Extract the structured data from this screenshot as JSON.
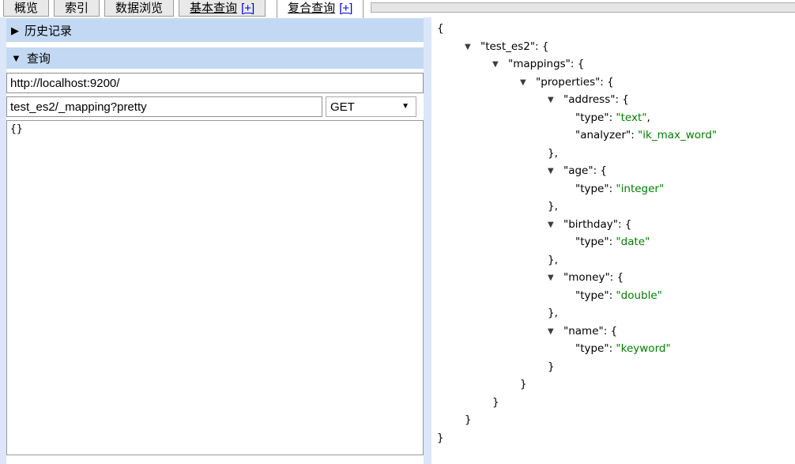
{
  "tabs": [
    {
      "label": "概览",
      "plus": "",
      "active": false,
      "underline": false
    },
    {
      "label": "索引",
      "plus": "",
      "active": false,
      "underline": false
    },
    {
      "label": "数据浏览",
      "plus": "",
      "active": false,
      "underline": false
    },
    {
      "label": "基本查询",
      "plus": "[+]",
      "active": false,
      "underline": true
    },
    {
      "label": "复合查询",
      "plus": "[+]",
      "active": true,
      "underline": true
    }
  ],
  "query_panel": {
    "history_header": "历史记录",
    "history_collapsed_icon": "collapsed-triangle-right",
    "query_header": "查询",
    "query_expanded_icon": "expanded-triangle-down",
    "url_value": "http://localhost:9200/",
    "path_value": "test_es2/_mapping?pretty",
    "method": "GET",
    "body_value": "{}"
  },
  "colors": {
    "panel_blue": "#dbe7f8",
    "header_blue": "#c3d9f3",
    "link_blue": "#0000e0",
    "json_string_green": "#008000"
  },
  "json_tree": {
    "lines": [
      {
        "level": 0,
        "arrow": false,
        "tokens": [
          {
            "t": "{",
            "c": "p"
          }
        ]
      },
      {
        "level": 1,
        "arrow": true,
        "tokens": [
          {
            "t": "\"test_es2\": {",
            "c": "p"
          }
        ]
      },
      {
        "level": 2,
        "arrow": true,
        "tokens": [
          {
            "t": "\"mappings\": {",
            "c": "p"
          }
        ]
      },
      {
        "level": 3,
        "arrow": true,
        "tokens": [
          {
            "t": "\"properties\": {",
            "c": "p"
          }
        ]
      },
      {
        "level": 4,
        "arrow": true,
        "tokens": [
          {
            "t": "\"address\": {",
            "c": "p"
          }
        ]
      },
      {
        "level": 5,
        "arrow": false,
        "tokens": [
          {
            "t": "\"type\": ",
            "c": "p"
          },
          {
            "t": "\"text\"",
            "c": "s"
          },
          {
            "t": ",",
            "c": "p"
          }
        ]
      },
      {
        "level": 5,
        "arrow": false,
        "tokens": [
          {
            "t": "\"analyzer\": ",
            "c": "p"
          },
          {
            "t": "\"ik_max_word\"",
            "c": "s"
          }
        ]
      },
      {
        "level": 4,
        "arrow": false,
        "tokens": [
          {
            "t": "},",
            "c": "p"
          }
        ]
      },
      {
        "level": 4,
        "arrow": true,
        "tokens": [
          {
            "t": "\"age\": {",
            "c": "p"
          }
        ]
      },
      {
        "level": 5,
        "arrow": false,
        "tokens": [
          {
            "t": "\"type\": ",
            "c": "p"
          },
          {
            "t": "\"integer\"",
            "c": "s"
          }
        ]
      },
      {
        "level": 4,
        "arrow": false,
        "tokens": [
          {
            "t": "},",
            "c": "p"
          }
        ]
      },
      {
        "level": 4,
        "arrow": true,
        "tokens": [
          {
            "t": "\"birthday\": {",
            "c": "p"
          }
        ]
      },
      {
        "level": 5,
        "arrow": false,
        "tokens": [
          {
            "t": "\"type\": ",
            "c": "p"
          },
          {
            "t": "\"date\"",
            "c": "s"
          }
        ]
      },
      {
        "level": 4,
        "arrow": false,
        "tokens": [
          {
            "t": "},",
            "c": "p"
          }
        ]
      },
      {
        "level": 4,
        "arrow": true,
        "tokens": [
          {
            "t": "\"money\": {",
            "c": "p"
          }
        ]
      },
      {
        "level": 5,
        "arrow": false,
        "tokens": [
          {
            "t": "\"type\": ",
            "c": "p"
          },
          {
            "t": "\"double\"",
            "c": "s"
          }
        ]
      },
      {
        "level": 4,
        "arrow": false,
        "tokens": [
          {
            "t": "},",
            "c": "p"
          }
        ]
      },
      {
        "level": 4,
        "arrow": true,
        "tokens": [
          {
            "t": "\"name\": {",
            "c": "p"
          }
        ]
      },
      {
        "level": 5,
        "arrow": false,
        "tokens": [
          {
            "t": "\"type\": ",
            "c": "p"
          },
          {
            "t": "\"keyword\"",
            "c": "s"
          }
        ]
      },
      {
        "level": 4,
        "arrow": false,
        "tokens": [
          {
            "t": "}",
            "c": "p"
          }
        ]
      },
      {
        "level": 3,
        "arrow": false,
        "tokens": [
          {
            "t": "}",
            "c": "p"
          }
        ]
      },
      {
        "level": 2,
        "arrow": false,
        "tokens": [
          {
            "t": "}",
            "c": "p"
          }
        ]
      },
      {
        "level": 1,
        "arrow": false,
        "tokens": [
          {
            "t": "}",
            "c": "p"
          }
        ]
      },
      {
        "level": 0,
        "arrow": false,
        "tokens": [
          {
            "t": "}",
            "c": "p"
          }
        ]
      }
    ]
  }
}
